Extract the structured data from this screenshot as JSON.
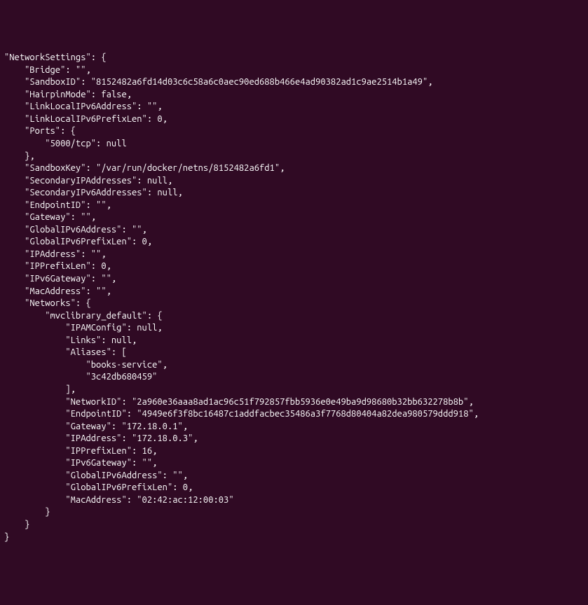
{
  "terminal": {
    "lines": [
      "\"NetworkSettings\": {",
      "    \"Bridge\": \"\",",
      "    \"SandboxID\": \"8152482a6fd14d03c6c58a6c0aec90ed688b466e4ad90382ad1c9ae2514b1a49\",",
      "    \"HairpinMode\": false,",
      "    \"LinkLocalIPv6Address\": \"\",",
      "    \"LinkLocalIPv6PrefixLen\": 0,",
      "    \"Ports\": {",
      "        \"5000/tcp\": null",
      "    },",
      "    \"SandboxKey\": \"/var/run/docker/netns/8152482a6fd1\",",
      "    \"SecondaryIPAddresses\": null,",
      "    \"SecondaryIPv6Addresses\": null,",
      "    \"EndpointID\": \"\",",
      "    \"Gateway\": \"\",",
      "    \"GlobalIPv6Address\": \"\",",
      "    \"GlobalIPv6PrefixLen\": 0,",
      "    \"IPAddress\": \"\",",
      "    \"IPPrefixLen\": 0,",
      "    \"IPv6Gateway\": \"\",",
      "    \"MacAddress\": \"\",",
      "    \"Networks\": {",
      "        \"mvclibrary_default\": {",
      "            \"IPAMConfig\": null,",
      "            \"Links\": null,",
      "            \"Aliases\": [",
      "                \"books-service\",",
      "                \"3c42db680459\"",
      "            ],",
      "            \"NetworkID\": \"2a960e36aaa8ad1ac96c51f792857fbb5936e0e49ba9d98680b32bb632278b8b\",",
      "            \"EndpointID\": \"4949e6f3f8bc16487c1addfacbec35486a3f7768d80404a82dea980579ddd918\",",
      "            \"Gateway\": \"172.18.0.1\",",
      "            \"IPAddress\": \"172.18.0.3\",",
      "            \"IPPrefixLen\": 16,",
      "            \"IPv6Gateway\": \"\",",
      "            \"GlobalIPv6Address\": \"\",",
      "            \"GlobalIPv6PrefixLen\": 0,",
      "            \"MacAddress\": \"02:42:ac:12:00:03\"",
      "        }",
      "    }",
      "}"
    ]
  }
}
